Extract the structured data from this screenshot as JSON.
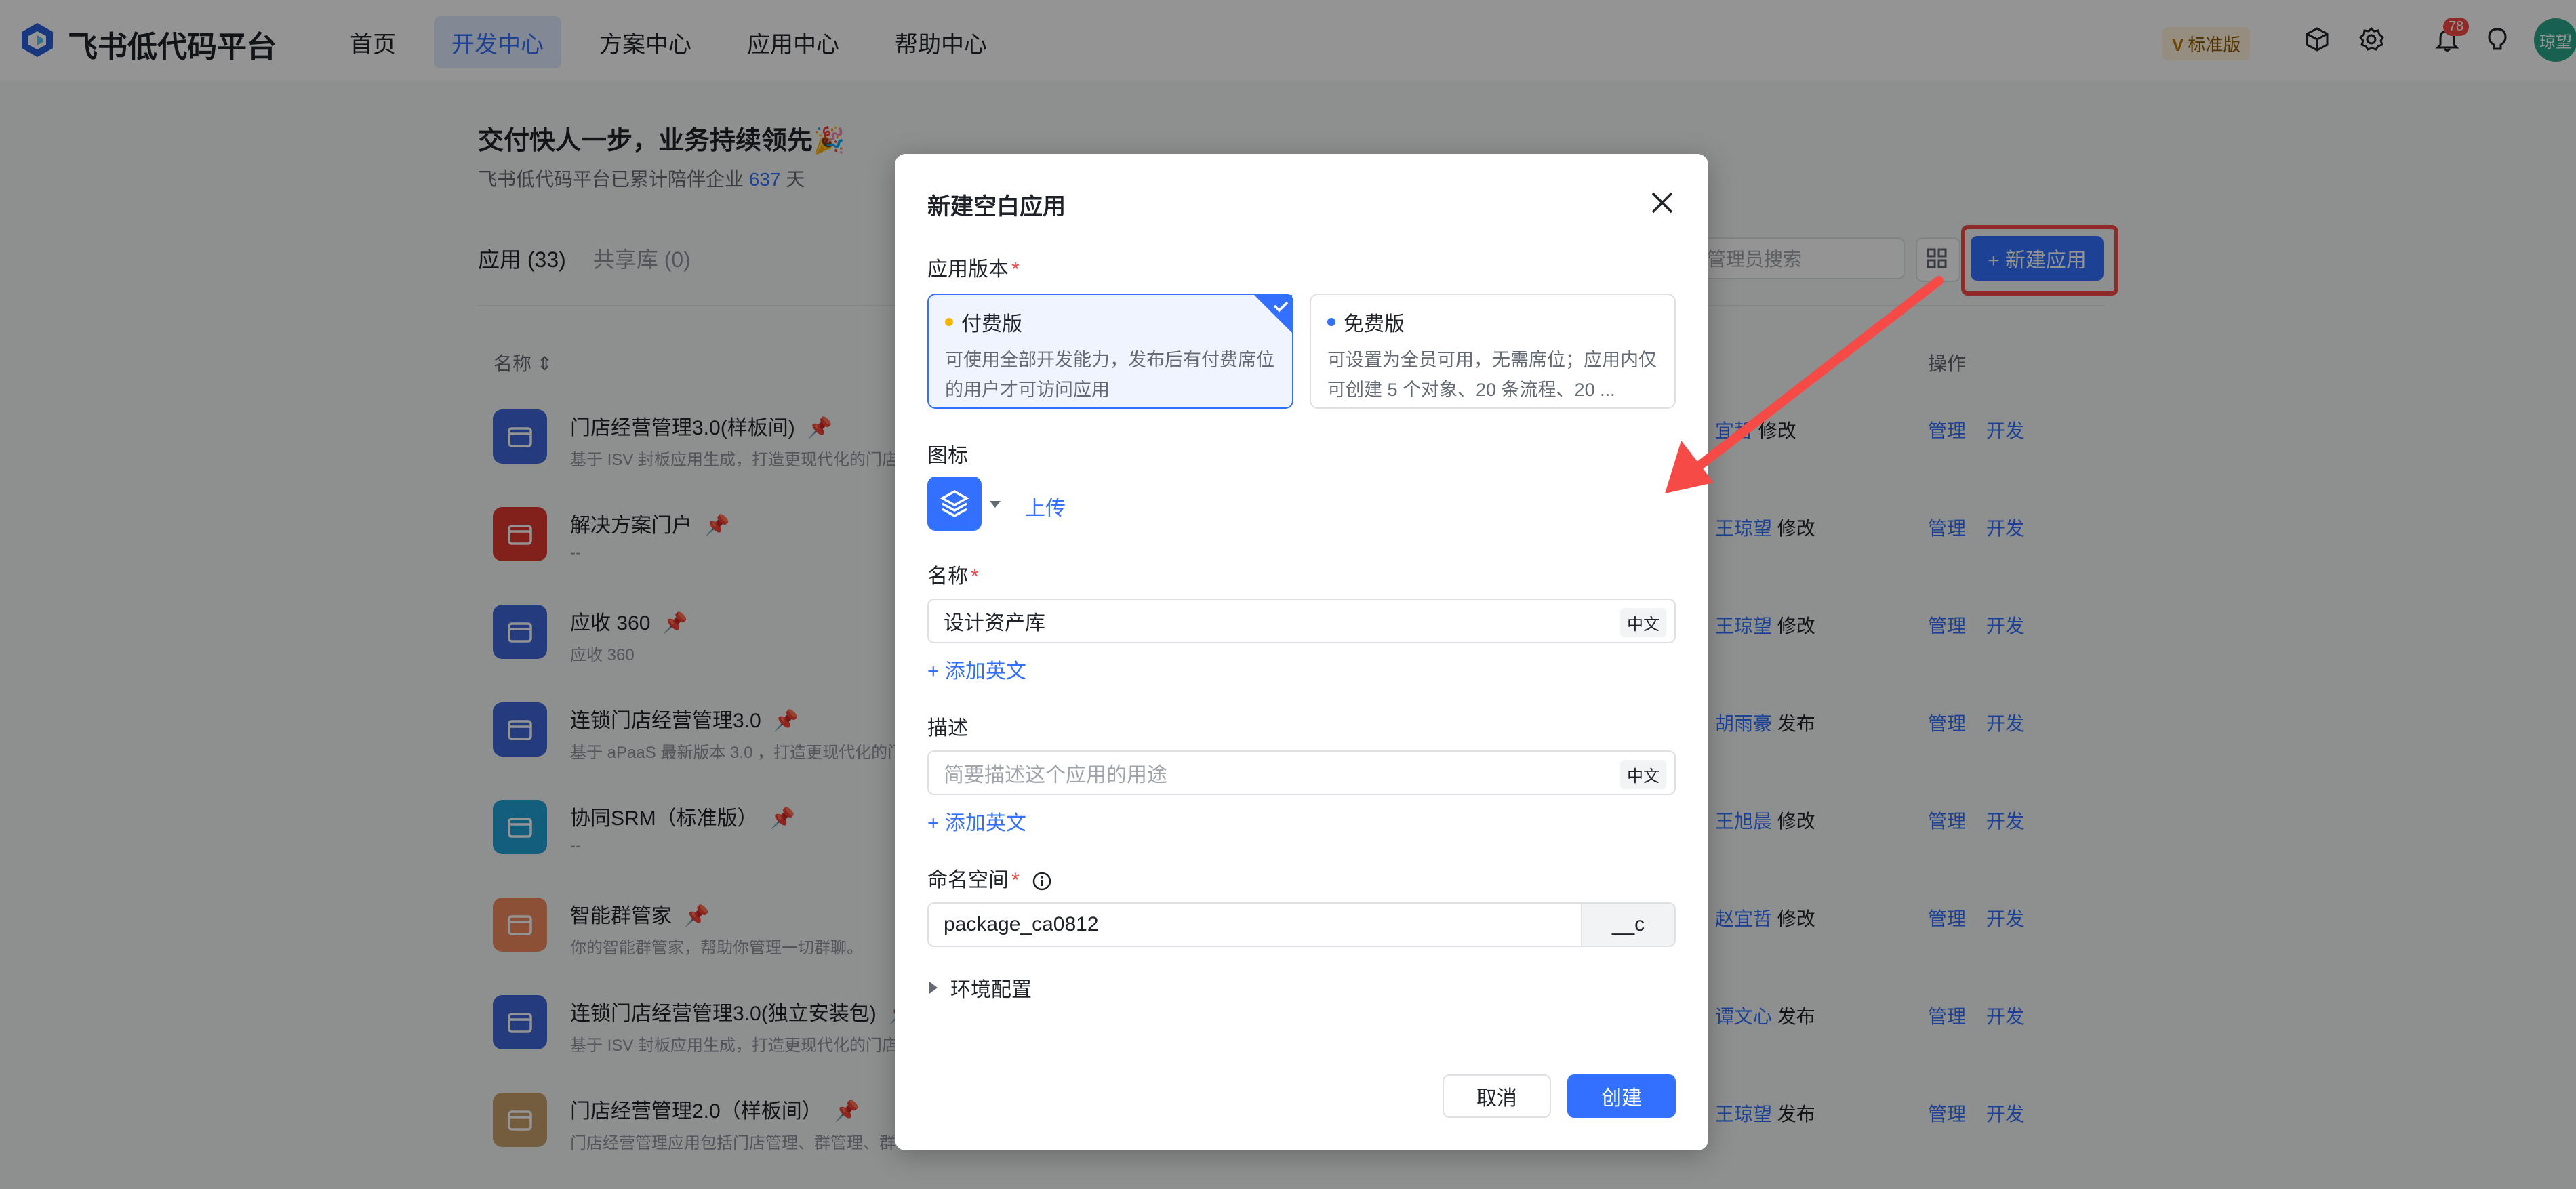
{
  "header": {
    "brand": "飞书低代码平台",
    "nav": [
      "首页",
      "开发中心",
      "方案中心",
      "应用中心",
      "帮助中心"
    ],
    "active_nav": 1,
    "edition_prefix": "V",
    "edition": "标准版",
    "notification_count": "78",
    "avatar_text": "琼望"
  },
  "hero": {
    "title": "交付快人一步，业务持续领先🎉",
    "subtitle_prefix": "飞书低代码平台已累计陪伴企业",
    "subtitle_count": "637",
    "subtitle_suffix": "天"
  },
  "tabs": [
    "应用 (33)",
    "共享库 (0)"
  ],
  "toolbar": {
    "search_placeholder": "管理员搜索",
    "new_app_label": "+ 新建应用"
  },
  "table": {
    "col_name": "名称",
    "col_ops": "操作",
    "op_manage": "管理",
    "op_dev": "开发",
    "rows": [
      {
        "name": "门店经营管理3.0(样板间)",
        "desc": "基于 ISV 封板应用生成，打造更现代化的门店",
        "owner": "宜哲",
        "action": "修改",
        "color": "#3f66d9"
      },
      {
        "name": "解决方案门户",
        "desc": "--",
        "owner": "王琼望",
        "action": "修改",
        "color": "#e0382f"
      },
      {
        "name": "应收 360",
        "desc": "应收 360",
        "owner": "王琼望",
        "action": "修改",
        "color": "#3f66d9"
      },
      {
        "name": "连锁门店经营管理3.0",
        "desc": "基于 aPaaS 最新版本 3.0 ，打造更现代化的门",
        "owner": "胡雨豪",
        "action": "发布",
        "color": "#3f66d9"
      },
      {
        "name": "协同SRM（标准版）",
        "desc": "--",
        "owner": "王旭晨",
        "action": "修改",
        "color": "#1fa3d6"
      },
      {
        "name": "智能群管家",
        "desc": "你的智能群管家，帮助你管理一切群聊。",
        "owner": "赵宜哲",
        "action": "修改",
        "color": "#f08a5d"
      },
      {
        "name": "连锁门店经营管理3.0(独立安装包)",
        "desc": "基于 ISV 封板应用生成，打造更现代化的门店",
        "owner": "谭文心",
        "action": "发布",
        "color": "#3f66d9"
      },
      {
        "name": "门店经营管理2.0（样板间）",
        "desc": "门店经营管理应用包括门店管理、群管理、群",
        "owner": "王琼望",
        "action": "发布",
        "color": "#c9a06b"
      }
    ]
  },
  "dialog": {
    "title": "新建空白应用",
    "version_label": "应用版本",
    "paid": {
      "title": "付费版",
      "desc": "可使用全部开发能力，发布后有付费席位的用户才可访问应用"
    },
    "free": {
      "title": "免费版",
      "desc": "可设置为全员可用，无需席位；应用内仅可创建 5 个对象、20 条流程、20 ..."
    },
    "icon_label": "图标",
    "upload": "上传",
    "name_label": "名称",
    "name_value": "设计资产库",
    "lang_tag": "中文",
    "add_english": "+ 添加英文",
    "desc_label": "描述",
    "desc_placeholder": "简要描述这个应用的用途",
    "namespace_label": "命名空间",
    "namespace_value": "package_ca0812",
    "namespace_suffix": "__c",
    "env_label": "环境配置",
    "cancel": "取消",
    "create": "创建"
  },
  "colors": {
    "accent": "#3370ff",
    "danger": "#f54a45",
    "paid_dot": "#f5b400"
  }
}
